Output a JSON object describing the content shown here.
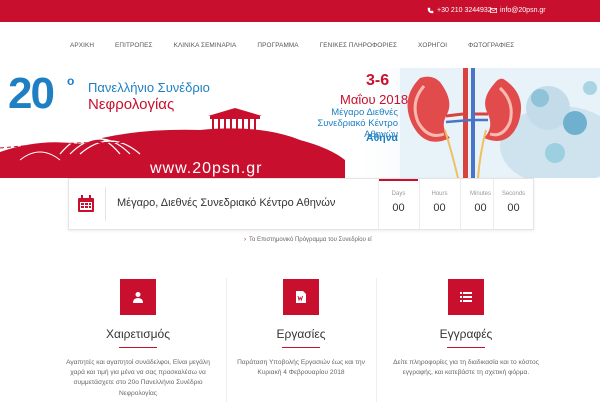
{
  "topbar": {
    "phone": "+30 210 3244932",
    "email": "info@20psn.gr",
    "phone_icon": "phone-icon",
    "email_icon": "envelope-icon",
    "color": "#c8102e"
  },
  "nav": {
    "items": [
      "ΑΡΧΙΚΗ",
      "ΕΠΙΤΡΟΠΕΣ",
      "ΚΛΙΝΙΚΑ ΣΕΜΙΝΑΡΙΑ",
      "ΠΡΟΓΡΑΜΜΑ",
      "ΓΕΝΙΚΕΣ ΠΛΗΡΟΦΟΡΙΕΣ",
      "ΧΟΡΗΓΟΙ",
      "ΦΩΤΟΓΡΑΦΙΕΣ"
    ]
  },
  "banner": {
    "number": "20",
    "sup": "ο",
    "title_line1": "Πανελλήνιο Συνέδριο",
    "title_line2": "Νεφρολογίας",
    "date_days": "3-6",
    "date_month": "Μαΐου 2018",
    "venue": "Μέγαρο Διεθνές Συνεδριακό Κέντρο Αθηνών",
    "city": "Αθήνα",
    "website": "www.20psn.gr",
    "brand_blue": "#1e7fc3",
    "brand_red": "#c8102e"
  },
  "countdown": {
    "icon": "calendar-icon",
    "venue": "Μέγαρο, Διεθνές Συνεδριακό Κέντρο Αθηνών",
    "units": [
      {
        "label": "Days",
        "value": "00"
      },
      {
        "label": "Hours",
        "value": "00"
      },
      {
        "label": "Minutes",
        "value": "00"
      },
      {
        "label": "Seconds",
        "value": "00"
      }
    ]
  },
  "notice": {
    "text": "Το Επιστημονικό Πρόγραμμα του Συνεδρίου εί"
  },
  "features": [
    {
      "icon": "user-icon",
      "title": "Χαιρετισμός",
      "text": "Αγαπητές και αγαπητοί συνάδελφοι, Είναι μεγάλη χαρά και τιμή για μένα να σας προσκαλέσω να συμμετάσχετε στο 20ο Πανελλήνιο Συνέδριο Νεφρολογίας"
    },
    {
      "icon": "word-document-icon",
      "title": "Εργασίες",
      "text": "Παράταση Υποβολής Εργασιών έως και την Κυριακή 4 Φεβρουαρίου 2018"
    },
    {
      "icon": "list-icon",
      "title": "Εγγραφές",
      "text": "Δείτε πληροφορίες για τη διαδικασία και το κόστος εγγραφής, και κατεβάστε τη σχετική φόρμα."
    }
  ]
}
